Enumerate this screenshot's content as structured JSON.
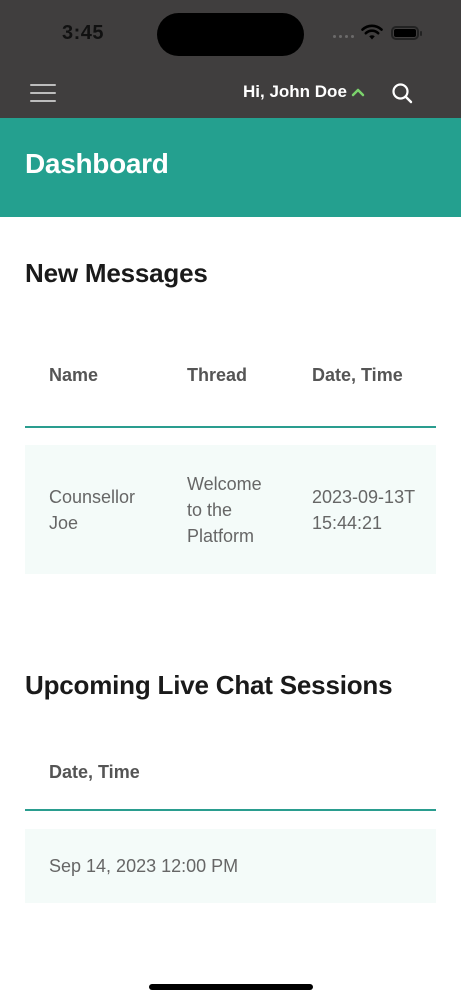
{
  "status_bar": {
    "time": "3:45"
  },
  "navbar": {
    "greeting": "Hi, John Doe",
    "accent_color": "#7bd26c"
  },
  "header": {
    "title": "Dashboard",
    "background": "#24a08f"
  },
  "messages": {
    "title": "New Messages",
    "columns": [
      "Name",
      "Thread",
      "Date, Time"
    ],
    "rows": [
      {
        "name": "Counsellor Joe",
        "thread": "Welcome to the Platform",
        "datetime": "2023-09-13T15:44:21"
      }
    ]
  },
  "sessions": {
    "title": "Upcoming Live Chat Sessions",
    "columns": [
      "Date, Time"
    ],
    "rows": [
      {
        "datetime": "Sep 14, 2023 12:00 PM"
      }
    ]
  },
  "icons": {
    "menu": "hamburger-menu-icon",
    "chevron": "chevron-up-icon",
    "search": "search-icon",
    "wifi": "wifi-icon",
    "battery": "battery-icon"
  }
}
